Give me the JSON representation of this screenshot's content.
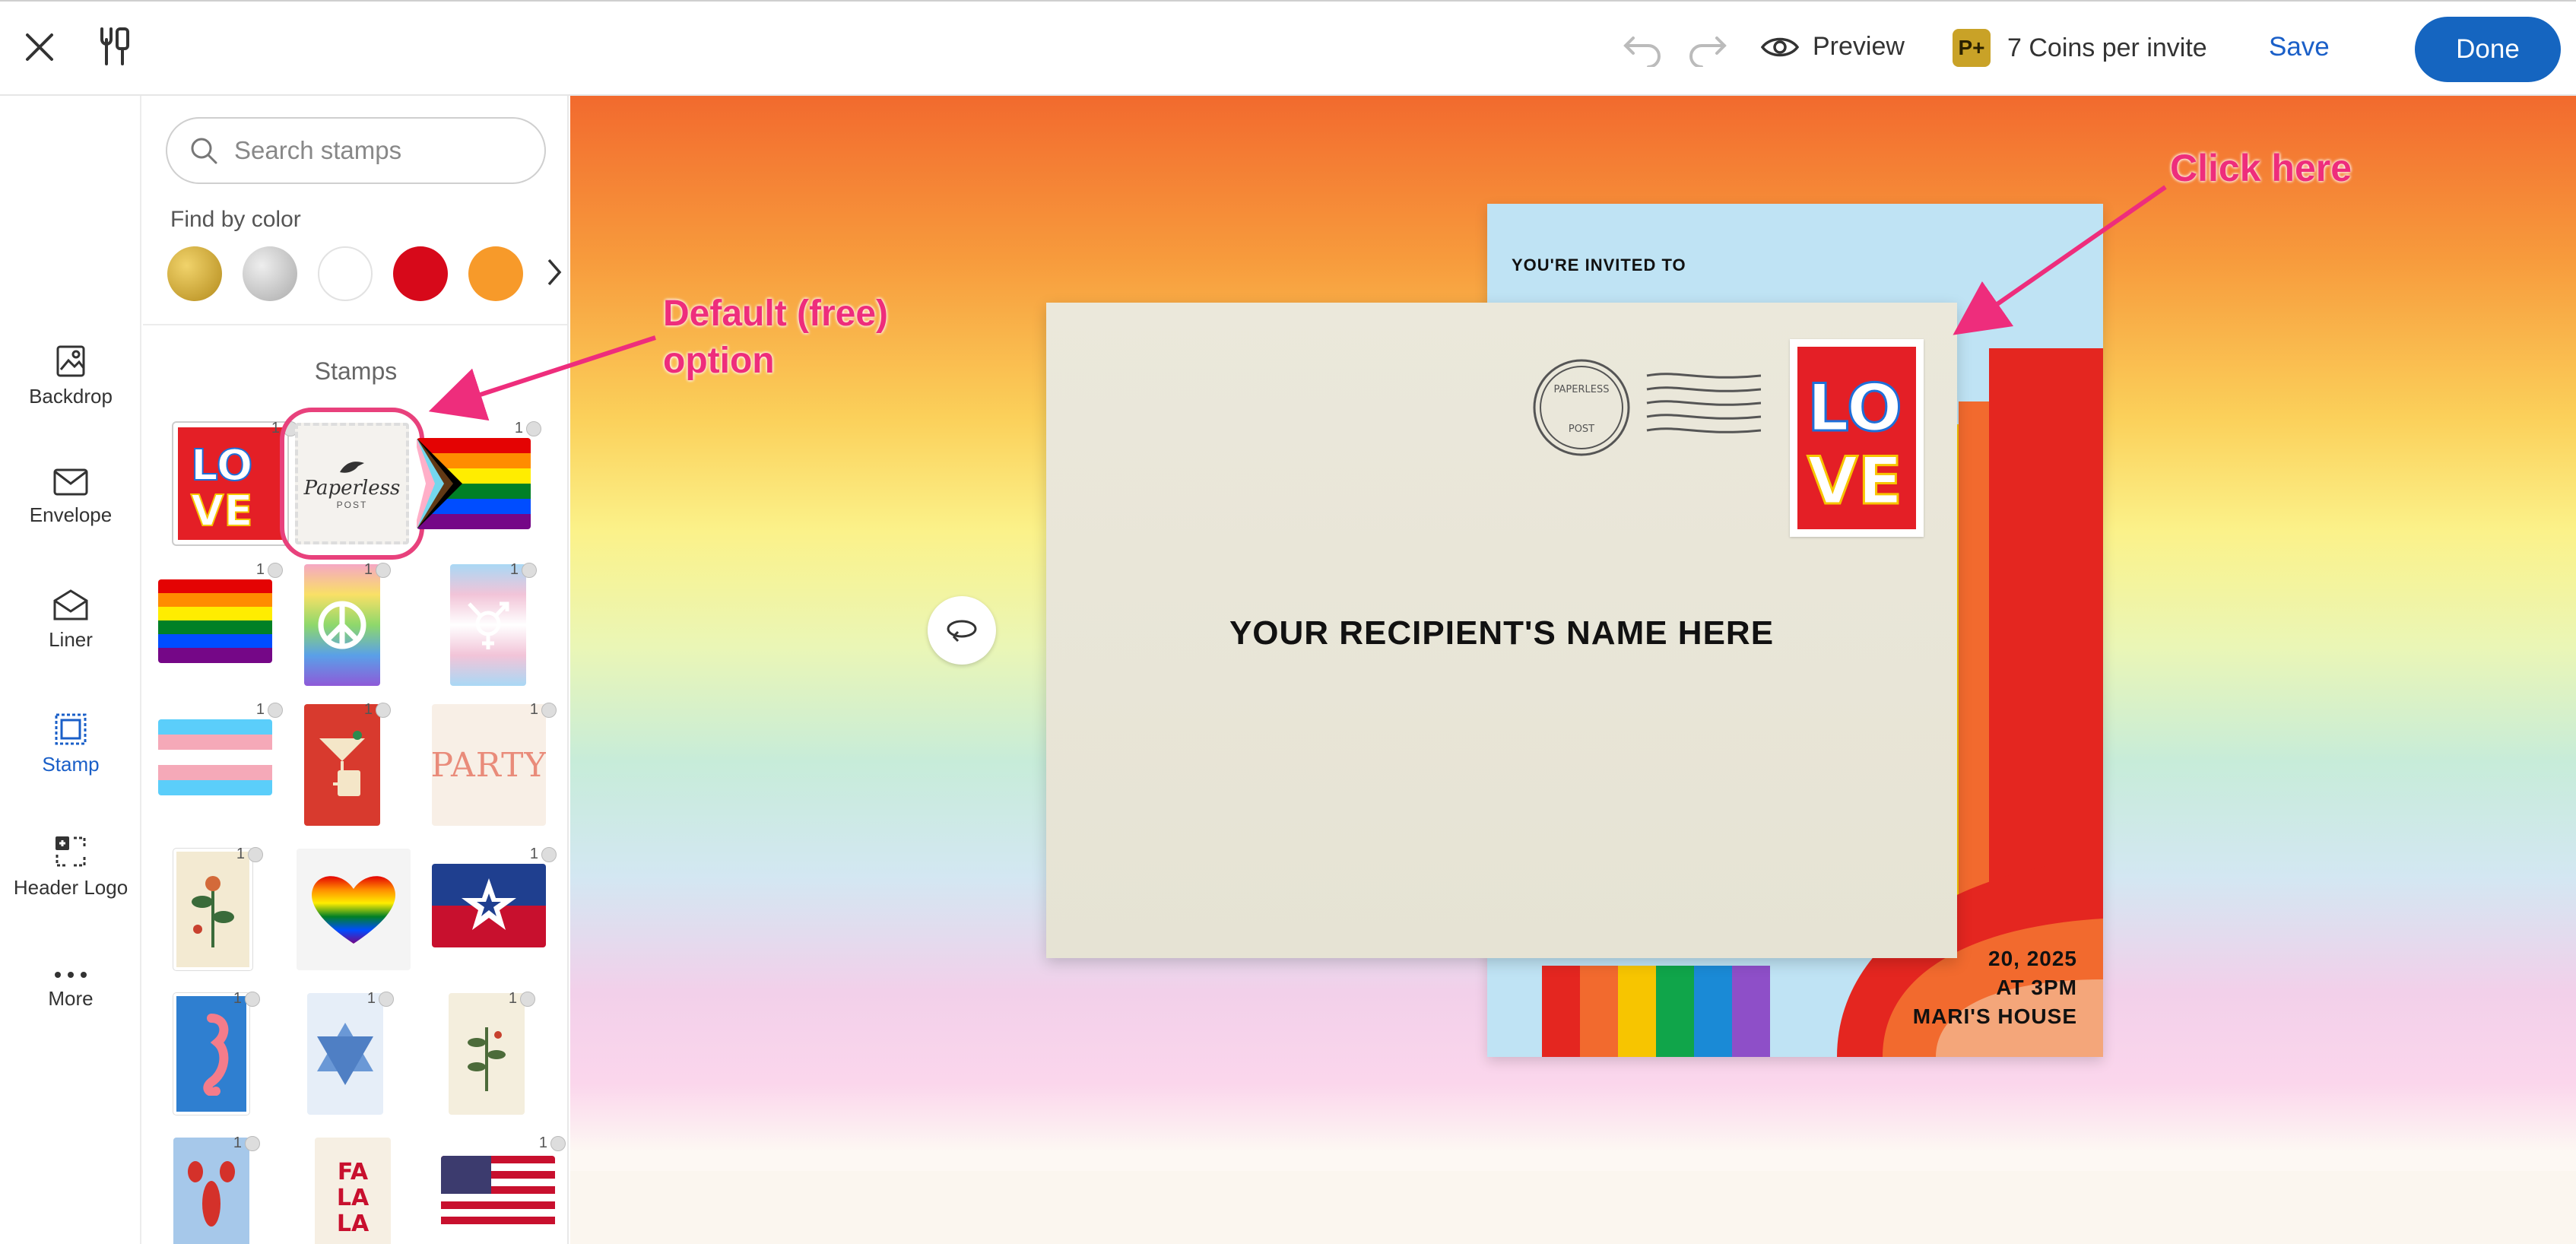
{
  "topbar": {
    "close": "close",
    "preview_label": "Preview",
    "coins_badge": "P+",
    "coins_label": "7 Coins per invite",
    "save_label": "Save",
    "done_label": "Done"
  },
  "rail": {
    "items": [
      {
        "label": "Backdrop"
      },
      {
        "label": "Envelope"
      },
      {
        "label": "Liner"
      },
      {
        "label": "Stamp"
      },
      {
        "label": "Header Logo"
      },
      {
        "label": "More"
      }
    ]
  },
  "panel": {
    "search_placeholder": "Search stamps",
    "find_by_color": "Find by color",
    "colors": [
      "#c9a227",
      "#c8c8c8",
      "#ffffff",
      "#d7091a",
      "#f79a2a"
    ],
    "section_title": "Stamps",
    "stamp_cost": "1",
    "stamps": [
      {
        "name": "love"
      },
      {
        "name": "paperless-post",
        "label": "Paperless",
        "sublabel": "POST"
      },
      {
        "name": "progress-flag"
      },
      {
        "name": "rainbow-flag"
      },
      {
        "name": "peace"
      },
      {
        "name": "trans-symbol"
      },
      {
        "name": "trans-flag"
      },
      {
        "name": "cocktails"
      },
      {
        "name": "party",
        "label": "PARTY"
      },
      {
        "name": "floral"
      },
      {
        "name": "rainbow-heart"
      },
      {
        "name": "juneteenth-star"
      },
      {
        "name": "seahorse"
      },
      {
        "name": "blue-star"
      },
      {
        "name": "wheat"
      },
      {
        "name": "lobster"
      },
      {
        "name": "falala",
        "label": "FA LA LA"
      },
      {
        "name": "us-flag"
      }
    ]
  },
  "preview": {
    "card_invite": "YOU'RE INVITED TO",
    "card_date_line1": "20, 2025",
    "card_date_line2": "AT 3PM",
    "card_date_line3": "MARI'S HOUSE",
    "postmark_top": "PAPERLESS",
    "postmark_bottom": "POST",
    "stamp_text": "LOVE",
    "recipient": "YOUR RECIPIENT'S NAME HERE"
  },
  "annotations": {
    "default_line1": "Default (free)",
    "default_line2": "option",
    "click_here": "Click here",
    "color": "#ee2d7c"
  }
}
